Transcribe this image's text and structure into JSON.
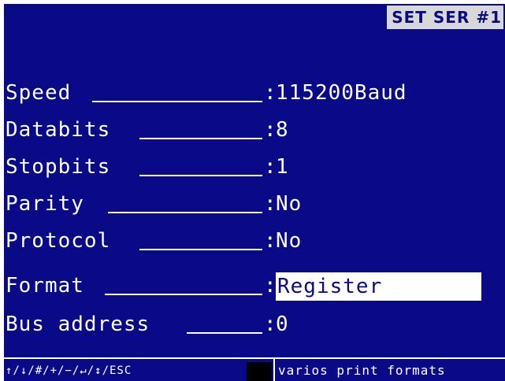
{
  "header": {
    "title": "SET SER #1"
  },
  "settings": [
    {
      "label": "Speed",
      "value": "115200Baud"
    },
    {
      "label": "Databits",
      "value": "8"
    },
    {
      "label": "Stopbits",
      "value": "1"
    },
    {
      "label": "Parity",
      "value": "No"
    },
    {
      "label": "Protocol",
      "value": "No"
    },
    {
      "label": "Format",
      "value": "Register"
    },
    {
      "label": "Bus address",
      "value": "0"
    }
  ],
  "separator": ":",
  "status_bar": {
    "keys": "↑/↓/#/+/−/↵/↕/ESC",
    "hint": "varios print formats"
  },
  "colors": {
    "background": "#0a0a88",
    "text": "#ffffff",
    "highlight": "#ffffff",
    "title_bg": "#d8d8d8"
  }
}
